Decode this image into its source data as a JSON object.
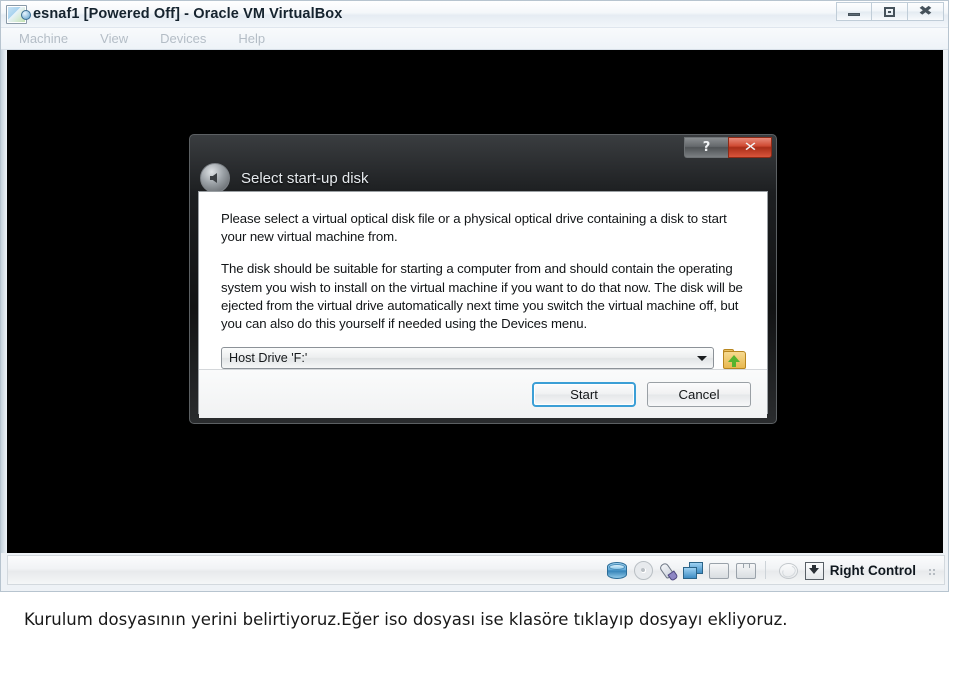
{
  "window": {
    "title": "esnaf1 [Powered Off] - Oracle VM VirtualBox",
    "app_icon": "virtualbox-icon",
    "controls": {
      "minimize": "minimize-icon",
      "maximize": "maximize-icon",
      "close": "close-icon"
    },
    "menus": [
      {
        "label": "Machine",
        "enabled": false
      },
      {
        "label": "View",
        "enabled": false
      },
      {
        "label": "Devices",
        "enabled": false
      },
      {
        "label": "Help",
        "enabled": false
      }
    ]
  },
  "statusbar": {
    "icons": [
      "harddisk-icon",
      "optical-disc-icon",
      "mouse-icon",
      "network-icon",
      "shared-folders-icon",
      "display-icon",
      "usb-disabled-icon"
    ],
    "host_key_icon": "host-key-icon",
    "host_key_label": "Right Control",
    "resize_grip": "resize-grip-icon"
  },
  "dialog": {
    "title": "Select start-up disk",
    "back_icon": "back-arrow-icon",
    "help_button_label": "?",
    "close_button_label": "✕",
    "paragraphs": [
      "Please select a virtual optical disk file or a physical optical drive containing a disk to start your new virtual machine from.",
      "The disk should be suitable for starting a computer from and should contain the operating system you wish to install on the virtual machine if you want to do that now. The disk will be ejected from the virtual drive automatically next time you switch the virtual machine off, but you can also do this yourself if needed using the Devices menu."
    ],
    "media_combo": {
      "value": "Host Drive 'F:'",
      "arrow_icon": "chevron-down-icon"
    },
    "browse_icon": "open-folder-icon",
    "buttons": {
      "start": "Start",
      "cancel": "Cancel"
    },
    "accent_color": "#3c9fd6",
    "close_color": "#cf4a33"
  },
  "caption": {
    "text": "Kurulum dosyasının yerini belirtiyoruz.Eğer iso dosyası ise klasöre tıklayıp dosyayı ekliyoruz."
  }
}
